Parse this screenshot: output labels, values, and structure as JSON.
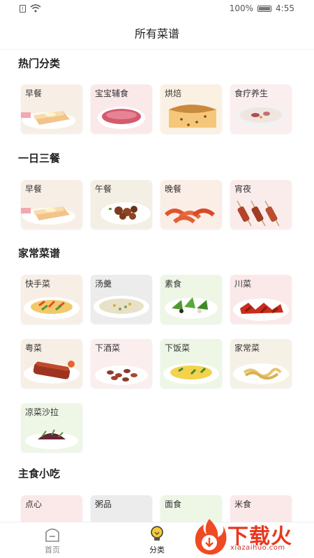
{
  "status": {
    "battery_pct": "100%",
    "time": "4:55"
  },
  "header": {
    "title": "所有菜谱"
  },
  "sections": [
    {
      "title": "热门分类",
      "items": [
        {
          "label": "早餐",
          "icon": "bread-icon"
        },
        {
          "label": "宝宝辅食",
          "icon": "baby-food-icon"
        },
        {
          "label": "烘焙",
          "icon": "cake-icon"
        },
        {
          "label": "食疗养生",
          "icon": "soup-bowl-icon"
        }
      ]
    },
    {
      "title": "一日三餐",
      "items": [
        {
          "label": "早餐",
          "icon": "bread-icon"
        },
        {
          "label": "午餐",
          "icon": "meat-dish-icon"
        },
        {
          "label": "晚餐",
          "icon": "shrimp-icon"
        },
        {
          "label": "宵夜",
          "icon": "skewer-icon"
        }
      ]
    },
    {
      "title": "家常菜谱",
      "items": [
        {
          "label": "快手菜",
          "icon": "noodle-plate-icon"
        },
        {
          "label": "汤羹",
          "icon": "soup-icon"
        },
        {
          "label": "素食",
          "icon": "salad-icon"
        },
        {
          "label": "川菜",
          "icon": "spicy-dish-icon"
        },
        {
          "label": "粤菜",
          "icon": "roast-meat-icon"
        },
        {
          "label": "下酒菜",
          "icon": "peanuts-icon"
        },
        {
          "label": "下饭菜",
          "icon": "stir-fry-icon"
        },
        {
          "label": "家常菜",
          "icon": "pasta-icon"
        },
        {
          "label": "凉菜沙拉",
          "icon": "cold-dish-icon"
        }
      ]
    },
    {
      "title": "主食小吃",
      "items": [
        {
          "label": "点心",
          "icon": "dessert-icon"
        },
        {
          "label": "粥品",
          "icon": "porridge-icon"
        },
        {
          "label": "面食",
          "icon": "noodle-icon"
        },
        {
          "label": "米食",
          "icon": "rice-icon"
        }
      ]
    }
  ],
  "tabs": [
    {
      "label": "首页",
      "icon": "home-icon",
      "active": false
    },
    {
      "label": "分类",
      "icon": "lightbulb-icon",
      "active": true
    },
    {
      "label": "",
      "icon": "",
      "active": false
    }
  ],
  "watermark": {
    "text": "下载火",
    "url": "xiazaihuo.com"
  },
  "colors": {
    "tile_bg_warm": "#f7efe6",
    "tile_bg_pink": "#fbe9ea",
    "tile_bg_green": "#eef6e6",
    "accent_red": "#e8371d"
  }
}
